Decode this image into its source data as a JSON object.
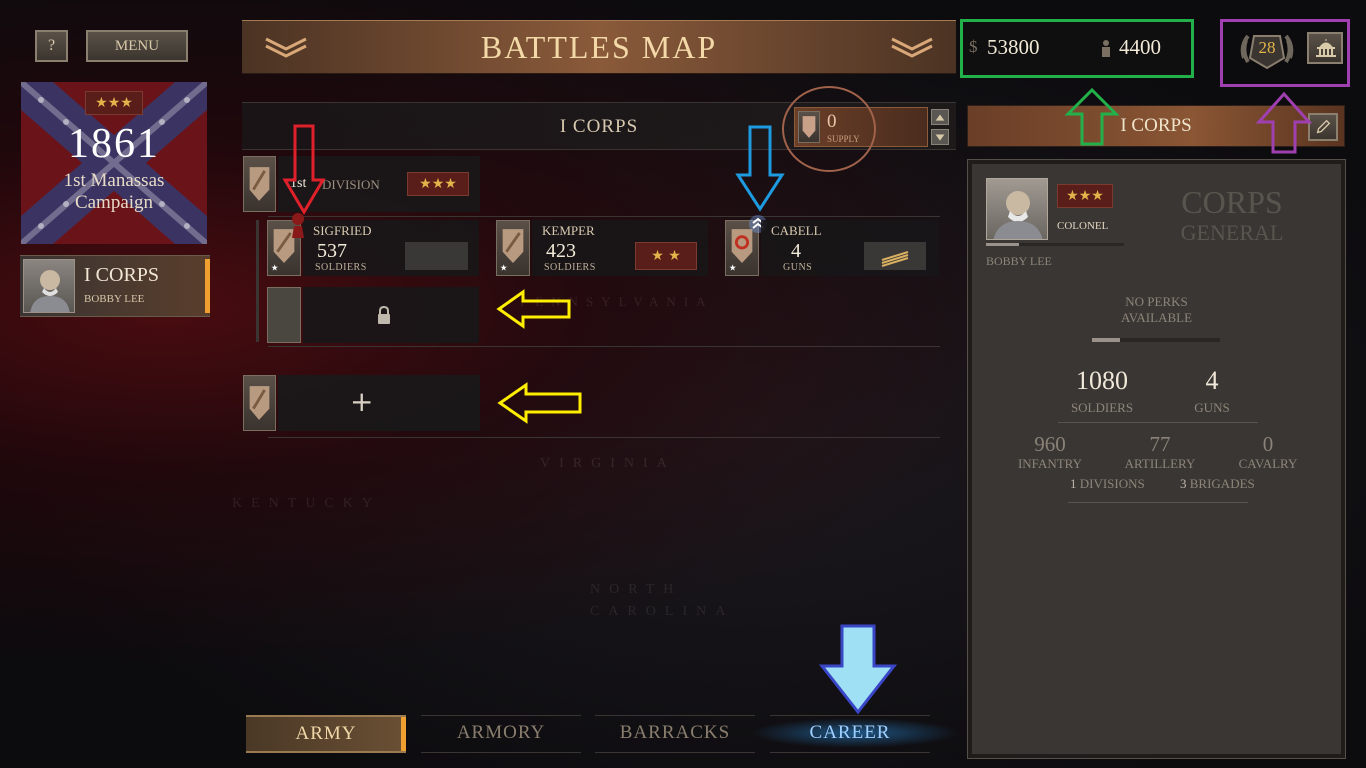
{
  "top_buttons": {
    "help": "?",
    "menu": "MENU"
  },
  "title": "BATTLES MAP",
  "resources": {
    "money_symbol": "$",
    "money": "53800",
    "manpower": "4400"
  },
  "rank": {
    "level": "28"
  },
  "campaign": {
    "stars": "★★★",
    "year": "1861",
    "name_line1": "1st Manassas",
    "name_line2": "Campaign"
  },
  "corps_card": {
    "name": "I CORPS",
    "commander": "BOBBY LEE"
  },
  "corps_row": {
    "name": "I CORPS",
    "supply_value": "0",
    "supply_label": "SUPPLY"
  },
  "division": {
    "number": "1st",
    "label": "DIVISION",
    "stars": "★★★"
  },
  "brigades": [
    {
      "name": "SIGFRIED",
      "value": "537",
      "unit": "SOLDIERS",
      "stars": ""
    },
    {
      "name": "KEMPER",
      "value": "423",
      "unit": "SOLDIERS",
      "stars": "★ ★"
    },
    {
      "name": "CABELL",
      "value": "4",
      "unit": "GUNS",
      "stars": ""
    }
  ],
  "add_symbol": "+",
  "general_panel": {
    "header": "I CORPS",
    "stars": "★★★",
    "rank": "COLONEL",
    "title_line1": "CORPS",
    "title_line2": "GENERAL",
    "name": "BOBBY LEE",
    "perks_line1": "NO PERKS",
    "perks_line2": "AVAILABLE",
    "soldiers_value": "1080",
    "soldiers_label": "SOLDIERS",
    "guns_value": "4",
    "guns_label": "GUNS",
    "infantry_value": "960",
    "infantry_label": "INFANTRY",
    "artillery_value": "77",
    "artillery_label": "ARTILLERY",
    "cavalry_value": "0",
    "cavalry_label": "CAVALRY",
    "divisions_count": "1",
    "divisions_label": "DIVISIONS",
    "brigades_count": "3",
    "brigades_label": "BRIGADES"
  },
  "map_labels": [
    "PENNSYLVANIA",
    "VIRGINIA",
    "KENTUCKY",
    "NORTH",
    "CAROLINA"
  ],
  "tabs": [
    "ARMY",
    "ARMORY",
    "BARRACKS",
    "CAREER"
  ],
  "active_tab": "ARMY",
  "highlight_tab": "CAREER",
  "colors": {
    "accent_gold": "#e4b34a",
    "accent_orange": "#f0a030",
    "annot_red": "#e0202a",
    "annot_blue": "#1e9be0",
    "annot_yellow": "#ffee00",
    "annot_green": "#22b04a",
    "annot_purple": "#a040b0",
    "annot_brown": "#a0624a",
    "annot_navy": "#3a46c8",
    "career_glow": "#2a8fe0"
  }
}
